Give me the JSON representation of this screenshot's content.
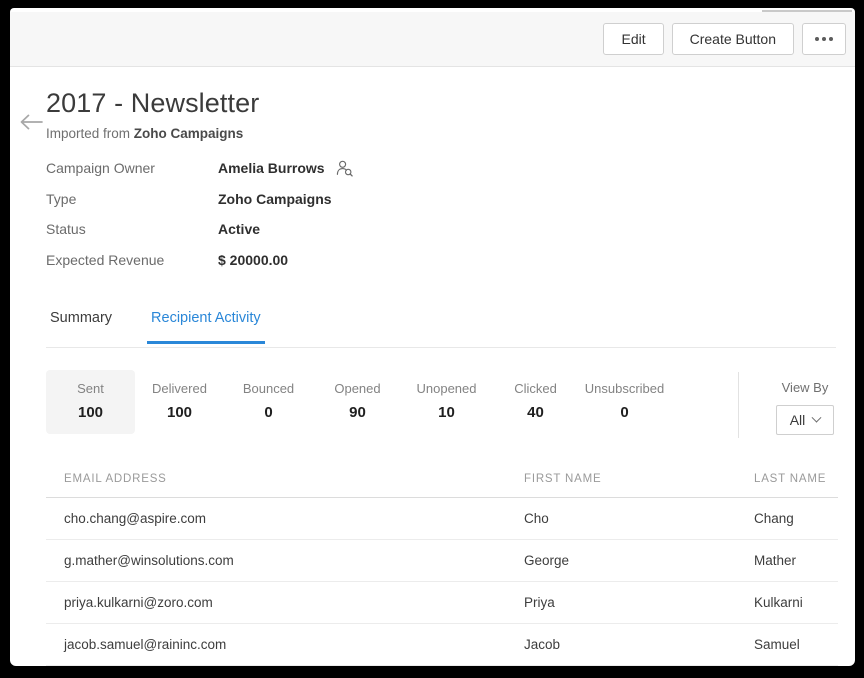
{
  "toolbar": {
    "edit_label": "Edit",
    "create_button_label": "Create Button",
    "more_label": "..."
  },
  "header": {
    "back_icon": "arrow-left-icon",
    "title": "2017 - Newsletter",
    "subtitle_prefix": "Imported from ",
    "subtitle_bold": "Zoho Campaigns"
  },
  "details": [
    {
      "label": "Campaign Owner",
      "value": "Amelia Burrows",
      "icon": "user-lookup-icon"
    },
    {
      "label": "Type",
      "value": "Zoho Campaigns"
    },
    {
      "label": "Status",
      "value": "Active"
    },
    {
      "label": "Expected Revenue",
      "value": "$ 20000.00"
    }
  ],
  "tabs": [
    {
      "label": "Summary",
      "active": false
    },
    {
      "label": "Recipient Activity",
      "active": true
    }
  ],
  "stats": [
    {
      "label": "Sent",
      "value": "100",
      "selected": true
    },
    {
      "label": "Delivered",
      "value": "100",
      "selected": false
    },
    {
      "label": "Bounced",
      "value": "0",
      "selected": false
    },
    {
      "label": "Opened",
      "value": "90",
      "selected": false
    },
    {
      "label": "Unopened",
      "value": "10",
      "selected": false
    },
    {
      "label": "Clicked",
      "value": "40",
      "selected": false
    },
    {
      "label": "Unsubscribed",
      "value": "0",
      "selected": false
    }
  ],
  "view_by": {
    "label": "View By",
    "selected": "All",
    "caret_icon": "chevron-down-icon"
  },
  "table": {
    "columns": [
      "EMAIL ADDRESS",
      "FIRST NAME",
      "LAST NAME"
    ],
    "rows": [
      {
        "email": "cho.chang@aspire.com",
        "first": "Cho",
        "last": "Chang"
      },
      {
        "email": "g.mather@winsolutions.com",
        "first": "George",
        "last": "Mather"
      },
      {
        "email": "priya.kulkarni@zoro.com",
        "first": "Priya",
        "last": "Kulkarni"
      },
      {
        "email": "jacob.samuel@raininc.com",
        "first": "Jacob",
        "last": "Samuel"
      }
    ]
  },
  "colors": {
    "accent": "#2a87d8",
    "header_bg": "#f7f7f7",
    "selected_stat_bg": "#f4f4f4",
    "text_primary": "#3b3b3b",
    "text_muted": "#838383"
  }
}
